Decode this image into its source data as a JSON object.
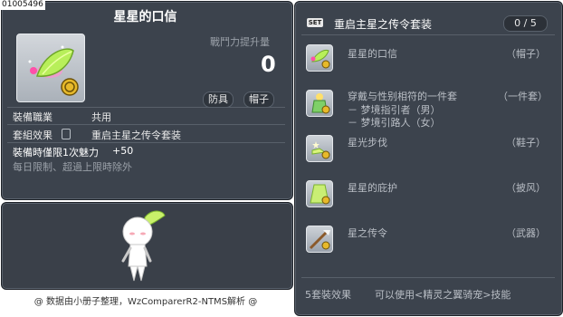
{
  "item": {
    "id": "01005496",
    "title": "星星的口信",
    "power_label": "戰鬥力提升量",
    "power_value": "0",
    "tags": [
      "防具",
      "帽子"
    ],
    "job_label": "裝備職業",
    "job_value": "共用",
    "set_label": "套組效果",
    "set_value": "重启主星之传令套装",
    "equip_limit_line": "裝備時僅限1次魅力",
    "equip_limit_bonus": "+50",
    "daily_limit": "每日限制、超過上限時除外"
  },
  "set": {
    "badge": "SET",
    "title": "重启主星之传令套装",
    "count": "0 / 5",
    "items": [
      {
        "name": "星星的口信",
        "slot": "（帽子）",
        "icon": "leaf-hat-icon"
      },
      {
        "name": "穿戴与性别相符的一件套",
        "slot": "（一件套）",
        "sub": [
          "－ 梦境指引者（男）",
          "－ 梦境引路人（女）"
        ],
        "icon": "outfit-icon"
      },
      {
        "name": "星光步伐",
        "slot": "（鞋子）",
        "icon": "star-shoes-icon"
      },
      {
        "name": "星星的庇护",
        "slot": "（披风）",
        "icon": "cape-icon"
      },
      {
        "name": "星之传令",
        "slot": "（武器）",
        "icon": "weapon-icon"
      }
    ],
    "bonus_label": "5套裝效果",
    "bonus_text": "可以使用<精灵之翼骑宠>技能"
  },
  "footer": "@ 数据由小册子整理，WzComparerR2-NTMS解析 @"
}
